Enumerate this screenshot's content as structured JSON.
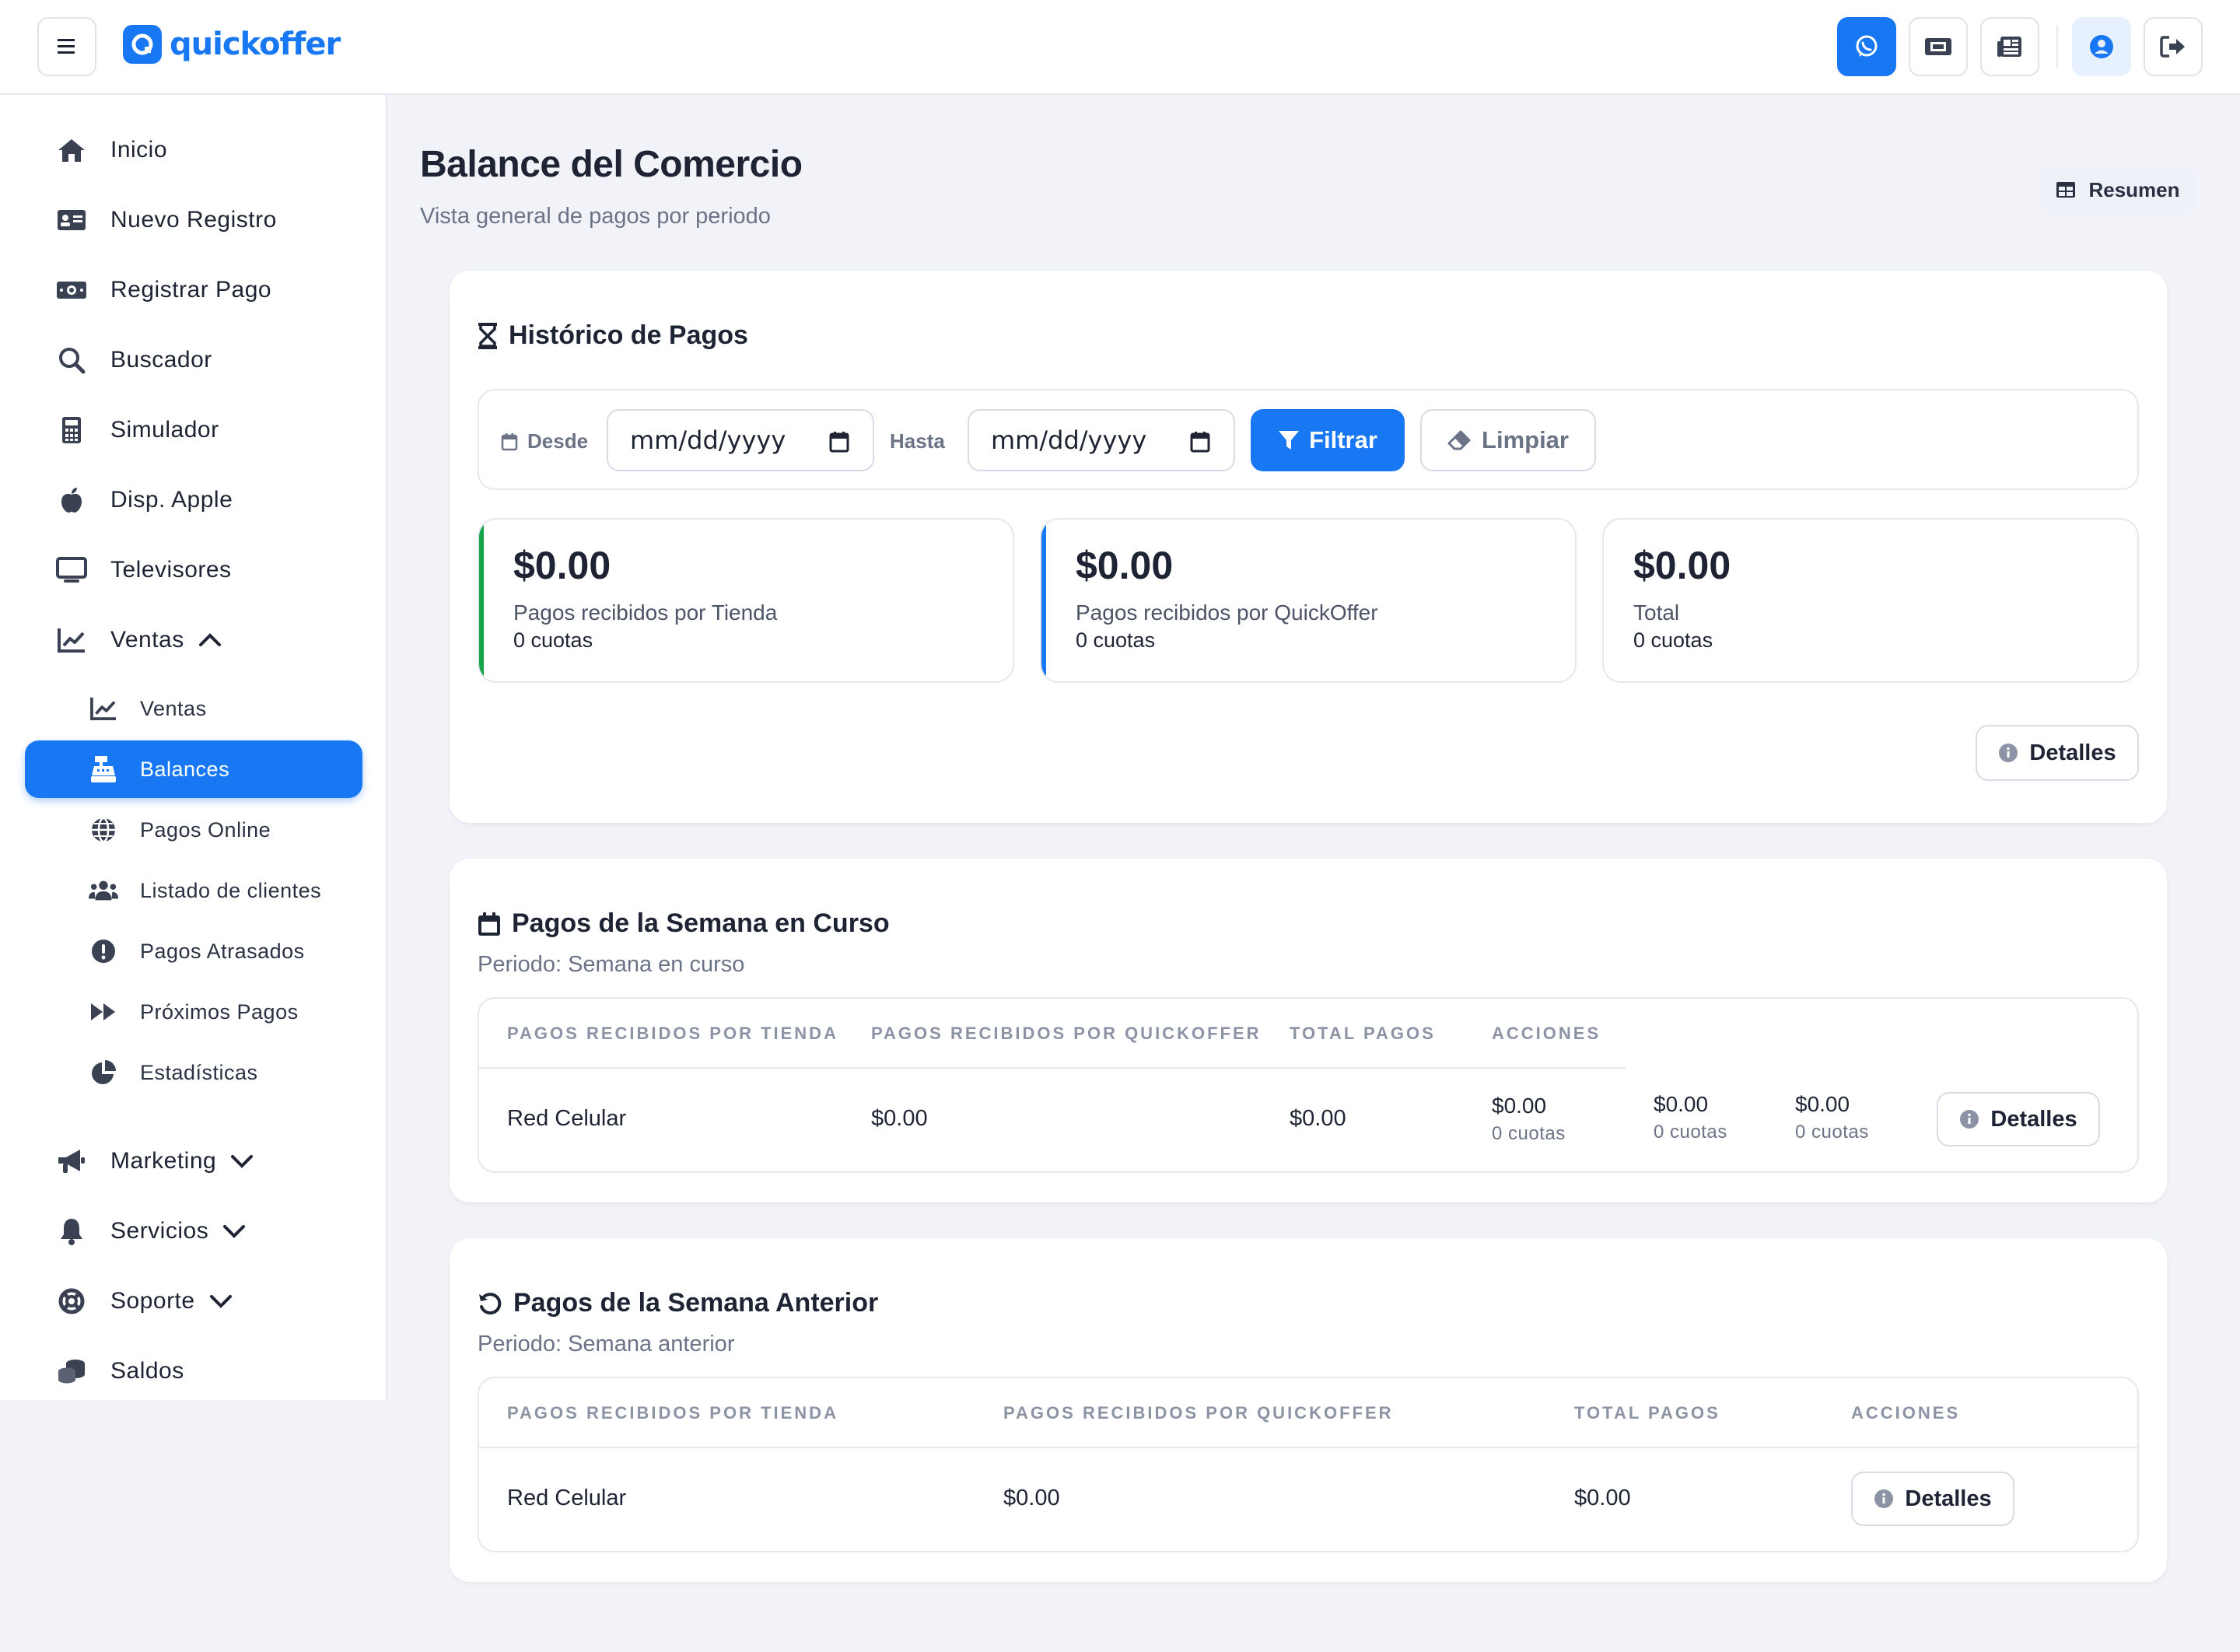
{
  "header": {
    "brand": "quickoffer",
    "buttons": [
      "menu-icon",
      "whatsapp-icon",
      "ticket-icon",
      "newspaper-icon",
      "user-circle-icon",
      "logout-icon"
    ]
  },
  "sidebar": {
    "items": [
      {
        "label": "Inicio",
        "icon": "home-icon"
      },
      {
        "label": "Nuevo Registro",
        "icon": "id-card-icon"
      },
      {
        "label": "Registrar Pago",
        "icon": "money-bill-icon"
      },
      {
        "label": "Buscador",
        "icon": "search-icon"
      },
      {
        "label": "Simulador",
        "icon": "calculator-icon"
      },
      {
        "label": "Disp. Apple",
        "icon": "apple-icon"
      },
      {
        "label": "Televisores",
        "icon": "tv-icon"
      },
      {
        "label": "Ventas",
        "icon": "chart-line-icon",
        "expanded": true
      }
    ],
    "sub_items": [
      {
        "label": "Ventas",
        "icon": "chart-line-icon"
      },
      {
        "label": "Balances",
        "icon": "cash-register-icon",
        "active": true
      },
      {
        "label": "Pagos Online",
        "icon": "globe-icon"
      },
      {
        "label": "Listado de clientes",
        "icon": "users-icon"
      },
      {
        "label": "Pagos Atrasados",
        "icon": "exclamation-circle-icon"
      },
      {
        "label": "Próximos Pagos",
        "icon": "forward-icon"
      },
      {
        "label": "Estadísticas",
        "icon": "pie-chart-icon"
      }
    ],
    "bottom_items": [
      {
        "label": "Marketing",
        "icon": "bullhorn-icon"
      },
      {
        "label": "Servicios",
        "icon": "bell-icon"
      },
      {
        "label": "Soporte",
        "icon": "life-ring-icon"
      },
      {
        "label": "Saldos",
        "icon": "coins-icon"
      }
    ]
  },
  "page": {
    "title": "Balance del Comercio",
    "subtitle": "Vista general de pagos por periodo",
    "resumen_label": "Resumen"
  },
  "historico": {
    "title": "Histórico de Pagos",
    "desde_label": "Desde",
    "hasta_label": "Hasta",
    "desde_value": "mm/dd/yyyy",
    "hasta_value": "mm/dd/yyyy",
    "filtrar_label": "Filtrar",
    "limpiar_label": "Limpiar",
    "stats": [
      {
        "amount": "$0.00",
        "label": "Pagos recibidos por Tienda",
        "count": "0 cuotas",
        "accent": "#16a34a"
      },
      {
        "amount": "$0.00",
        "label": "Pagos recibidos por QuickOffer",
        "count": "0 cuotas",
        "accent": "#1877f2"
      },
      {
        "amount": "$0.00",
        "label": "Total",
        "count": "0 cuotas",
        "accent": ""
      }
    ],
    "detalles_label": "Detalles"
  },
  "semana_curso": {
    "title": "Pagos de la Semana en Curso",
    "period": "Periodo: Semana en curso",
    "columns": [
      "PAGOS RECIBIDOS POR TIENDA",
      "PAGOS RECIBIDOS POR QUICKOFFER",
      "TOTAL PAGOS",
      "ACCIONES"
    ],
    "row": {
      "tienda": "Red Celular",
      "quickoffer": "$0.00",
      "total": "$0.00",
      "mini": [
        {
          "value": "$0.00",
          "count": "0 cuotas"
        },
        {
          "value": "$0.00",
          "count": "0 cuotas"
        },
        {
          "value": "$0.00",
          "count": "0 cuotas"
        }
      ],
      "detalles_label": "Detalles"
    }
  },
  "semana_anterior": {
    "title": "Pagos de la Semana Anterior",
    "period": "Periodo: Semana anterior",
    "columns": [
      "PAGOS RECIBIDOS POR TIENDA",
      "PAGOS RECIBIDOS POR QUICKOFFER",
      "TOTAL PAGOS",
      "ACCIONES"
    ],
    "row": {
      "tienda": "Red Celular",
      "quickoffer": "$0.00",
      "total": "$0.00",
      "detalles_label": "Detalles"
    }
  },
  "colors": {
    "primary": "#1877f2",
    "success": "#16a34a",
    "text": "#1e2434",
    "muted": "#6b7386"
  }
}
